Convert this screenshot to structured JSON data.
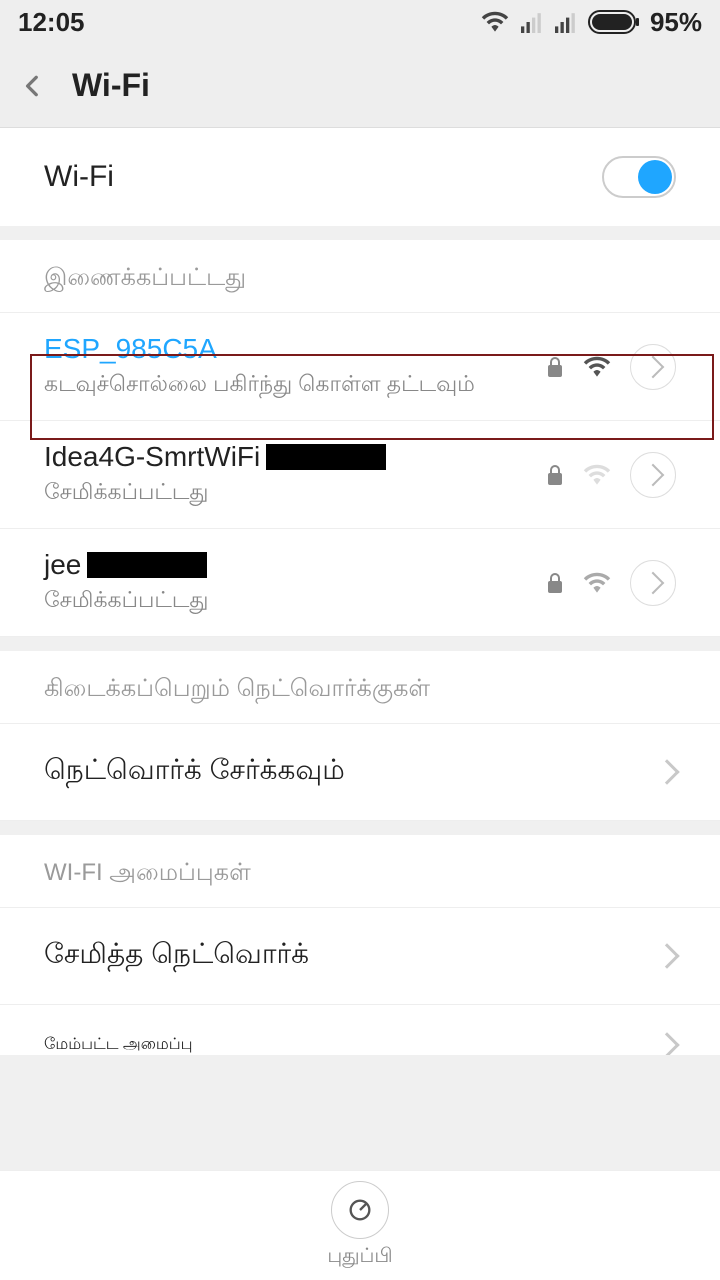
{
  "statusbar": {
    "time": "12:05",
    "battery_pct": "95%"
  },
  "header": {
    "title": "Wi-Fi"
  },
  "toggle": {
    "label": "Wi-Fi",
    "on": true
  },
  "sections": {
    "connected_label": "இணைக்கப்பட்டது",
    "available_label": "கிடைக்கப்பெறும் நெட்வொர்க்குகள்",
    "wifi_settings_label": "WI-FI அமைப்புகள்"
  },
  "networks": [
    {
      "name": "ESP_985C5A",
      "subtitle": "கடவுச்சொல்லை பகிர்ந்து கொள்ள தட்டவும்",
      "active": true,
      "locked": true,
      "signal": "strong"
    },
    {
      "name": "Idea4G-SmrtWiFi",
      "subtitle": "சேமிக்கப்பட்டது",
      "active": false,
      "locked": true,
      "signal": "weak",
      "redacted_w": 120
    },
    {
      "name": "jee",
      "subtitle": "சேமிக்கப்பட்டது",
      "active": false,
      "locked": true,
      "signal": "medium",
      "redacted_w": 120
    }
  ],
  "actions": {
    "add_network": "நெட்வொர்க் சேர்க்கவும்",
    "saved_networks": "சேமித்த நெட்வொர்க்",
    "advanced": "மேம்பட்ட அமைப்பு"
  },
  "footer": {
    "refresh": "புதுப்பி"
  }
}
